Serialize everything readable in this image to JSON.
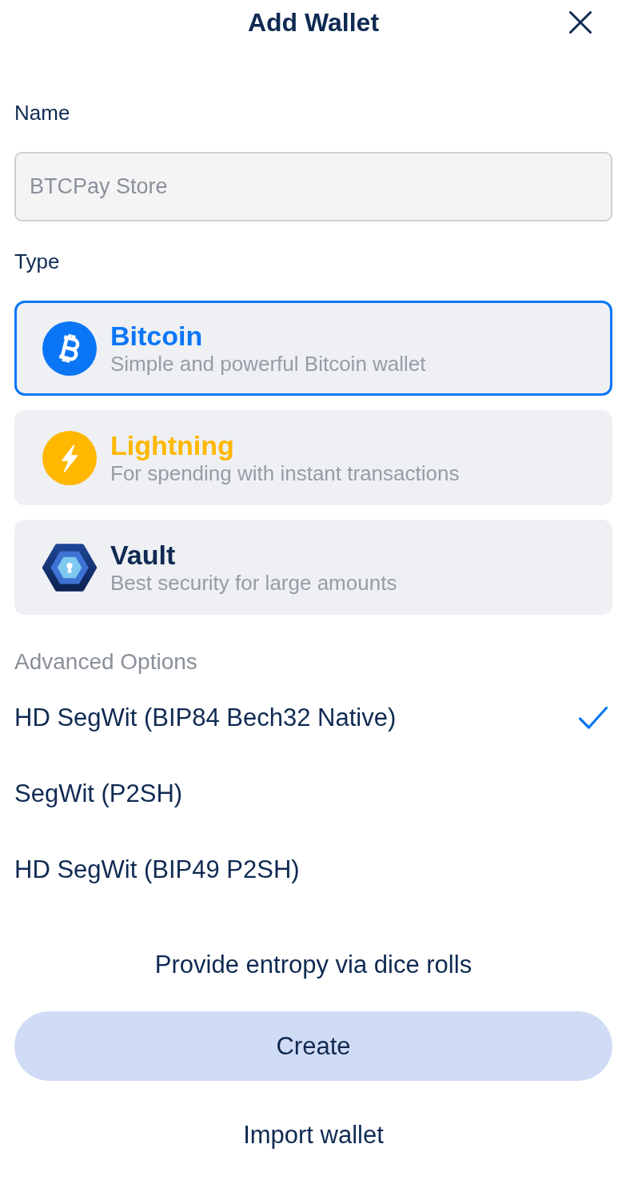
{
  "header": {
    "title": "Add Wallet"
  },
  "name_field": {
    "label": "Name",
    "placeholder": "BTCPay Store"
  },
  "type_section": {
    "label": "Type",
    "options": [
      {
        "kind": "bitcoin",
        "title": "Bitcoin",
        "subtitle": "Simple and powerful Bitcoin wallet",
        "color": "#0a76f6",
        "selected": true
      },
      {
        "kind": "lightning",
        "title": "Lightning",
        "subtitle": "For spending with instant transactions",
        "color": "#ffb700",
        "selected": false
      },
      {
        "kind": "vault",
        "title": "Vault",
        "subtitle": "Best security for large amounts",
        "color": "#0f2a52",
        "selected": false
      }
    ]
  },
  "advanced_options": {
    "label": "Advanced Options",
    "items": [
      {
        "label": "HD SegWit (BIP84 Bech32 Native)",
        "selected": true
      },
      {
        "label": "SegWit (P2SH)",
        "selected": false
      },
      {
        "label": "HD SegWit (BIP49 P2SH)",
        "selected": false
      }
    ]
  },
  "entropy_link": "Provide entropy via dice rolls",
  "create_button": {
    "label": "Create",
    "disabled": true
  },
  "import_link": "Import wallet"
}
